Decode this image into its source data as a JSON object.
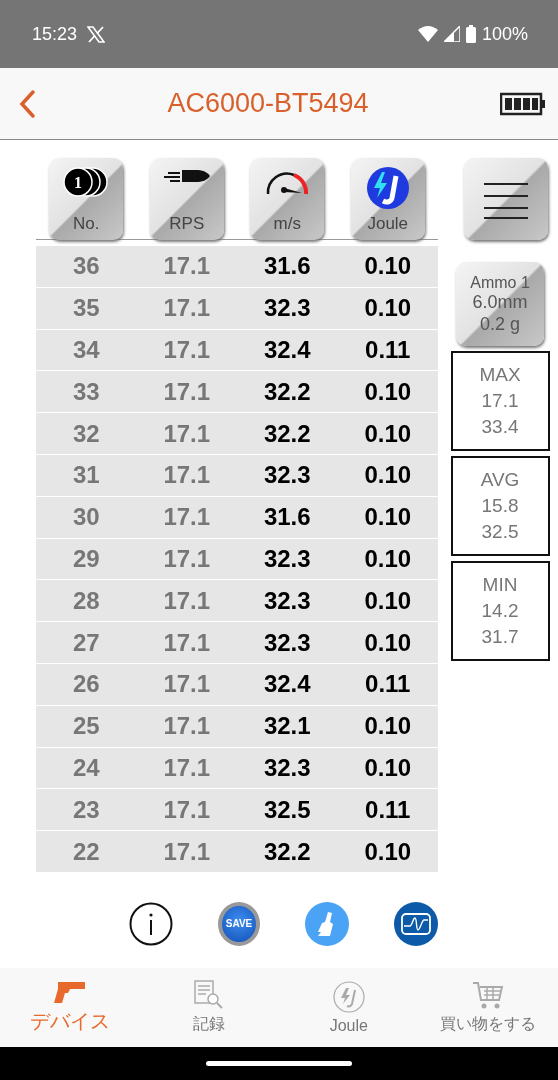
{
  "status_bar": {
    "time": "15:23",
    "battery": "100%"
  },
  "header": {
    "title": "AC6000-BT5494"
  },
  "columns": [
    {
      "label": "No.",
      "kind": "coins",
      "badge": "1"
    },
    {
      "label": "RPS",
      "kind": "bullet"
    },
    {
      "label": "m/s",
      "kind": "gauge"
    },
    {
      "label": "Joule",
      "kind": "joule"
    }
  ],
  "rows": [
    [
      "36",
      "17.1",
      "31.6",
      "0.10"
    ],
    [
      "35",
      "17.1",
      "32.3",
      "0.10"
    ],
    [
      "34",
      "17.1",
      "32.4",
      "0.11"
    ],
    [
      "33",
      "17.1",
      "32.2",
      "0.10"
    ],
    [
      "32",
      "17.1",
      "32.2",
      "0.10"
    ],
    [
      "31",
      "17.1",
      "32.3",
      "0.10"
    ],
    [
      "30",
      "17.1",
      "31.6",
      "0.10"
    ],
    [
      "29",
      "17.1",
      "32.3",
      "0.10"
    ],
    [
      "28",
      "17.1",
      "32.3",
      "0.10"
    ],
    [
      "27",
      "17.1",
      "32.3",
      "0.10"
    ],
    [
      "26",
      "17.1",
      "32.4",
      "0.11"
    ],
    [
      "25",
      "17.1",
      "32.1",
      "0.10"
    ],
    [
      "24",
      "17.1",
      "32.3",
      "0.10"
    ],
    [
      "23",
      "17.1",
      "32.5",
      "0.11"
    ],
    [
      "22",
      "17.1",
      "32.2",
      "0.10"
    ]
  ],
  "ammo": [
    "Ammo 1",
    "6.0mm",
    "0.2 g"
  ],
  "stats": [
    {
      "label": "MAX",
      "values": [
        "17.1",
        "33.4"
      ]
    },
    {
      "label": "AVG",
      "values": [
        "15.8",
        "32.5"
      ]
    },
    {
      "label": "MIN",
      "values": [
        "14.2",
        "31.7"
      ]
    }
  ],
  "actions": [
    {
      "kind": "info"
    },
    {
      "kind": "save",
      "label": "SAVE"
    },
    {
      "kind": "clean"
    },
    {
      "kind": "graph"
    }
  ],
  "tabs": [
    {
      "label": "デバイス",
      "kind": "pistol",
      "selected": true
    },
    {
      "label": "記録",
      "kind": "record",
      "selected": false
    },
    {
      "label": "Joule",
      "kind": "joule",
      "selected": false
    },
    {
      "label": "買い物をする",
      "kind": "cart",
      "selected": false
    }
  ]
}
